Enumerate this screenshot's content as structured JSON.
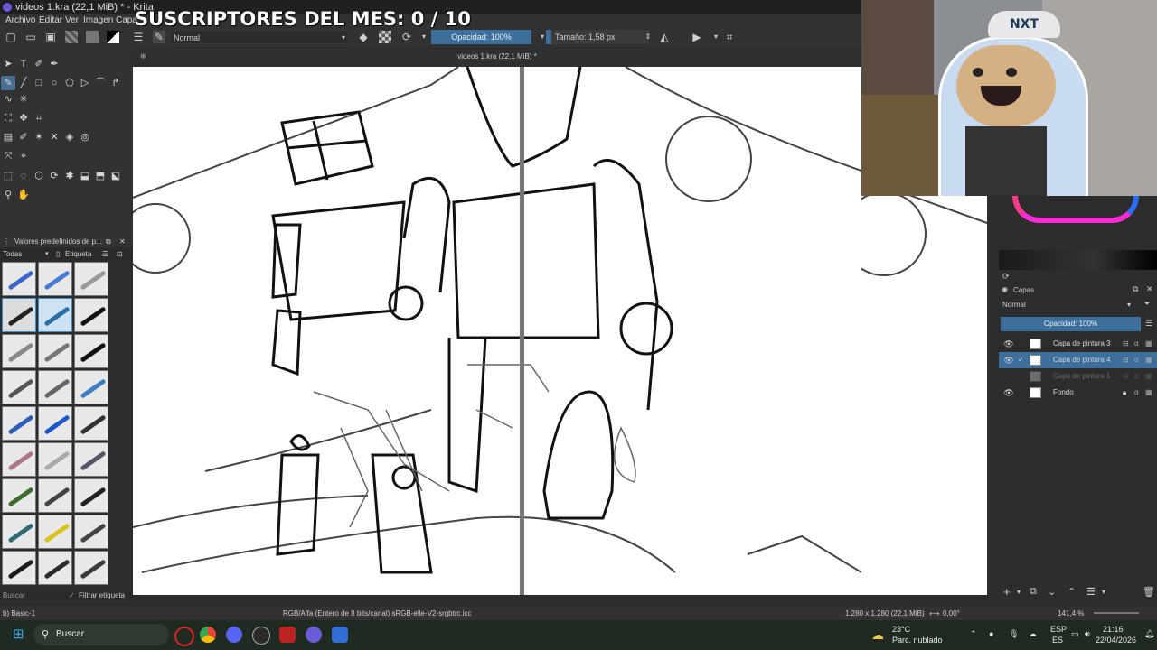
{
  "window": {
    "title": "videos 1.kra (22,1 MiB) * - Krita"
  },
  "menu": [
    "Archivo",
    "Editar",
    "Ver",
    "Imagen",
    "Capa"
  ],
  "overlay": {
    "subscribers_text": "SUSCRIPTORES DEL MES: 0 / 10"
  },
  "toolbar": {
    "blend_mode": "Normal",
    "opacity_label": "Opacidad: 100%",
    "size_label": "Tamaño: 1,58 px"
  },
  "document": {
    "tab_title": "videos 1.kra (22,1 MiB) *"
  },
  "brush_presets": {
    "header": "Valores predefinidos de p...",
    "tag_filter": "Todas",
    "tag_label": "Etiqueta",
    "search_placeholder": "Buscar",
    "filter_tag_label": "Filtrar etiqueta"
  },
  "layers": {
    "title": "Capas",
    "blend_mode": "Normal",
    "opacity_label": "Opacidad:  100%",
    "items": [
      {
        "name": "Capa de pintura 3",
        "visible": true,
        "selected": false
      },
      {
        "name": "Capa de pintura 4",
        "visible": true,
        "selected": true
      },
      {
        "name": "Capa de pintura 1",
        "visible": false,
        "selected": false
      },
      {
        "name": "Fondo",
        "visible": true,
        "selected": false,
        "locked": true
      }
    ]
  },
  "status": {
    "brush": "b) Basic-1",
    "color_space": "RGB/Alfa (Entero de 8 bits/canal)  sRGB-elle-V2-srgbtrc.icc",
    "dimensions": "1.280 x 1.280 (22,1 MiB)",
    "rotation": "0,00°",
    "zoom": "141,4 %"
  },
  "webcam": {
    "cap_text": "NXT"
  },
  "taskbar": {
    "search_label": "Buscar",
    "weather_temp": "23°C",
    "weather_desc": "Parc. nublado",
    "lang_top": "ESP",
    "lang_bottom": "ES",
    "time": "21:16",
    "date": "22/04/2026"
  },
  "colors": {
    "accent": "#3d6e9c",
    "panel": "#323232",
    "canvas": "#ffffff"
  }
}
